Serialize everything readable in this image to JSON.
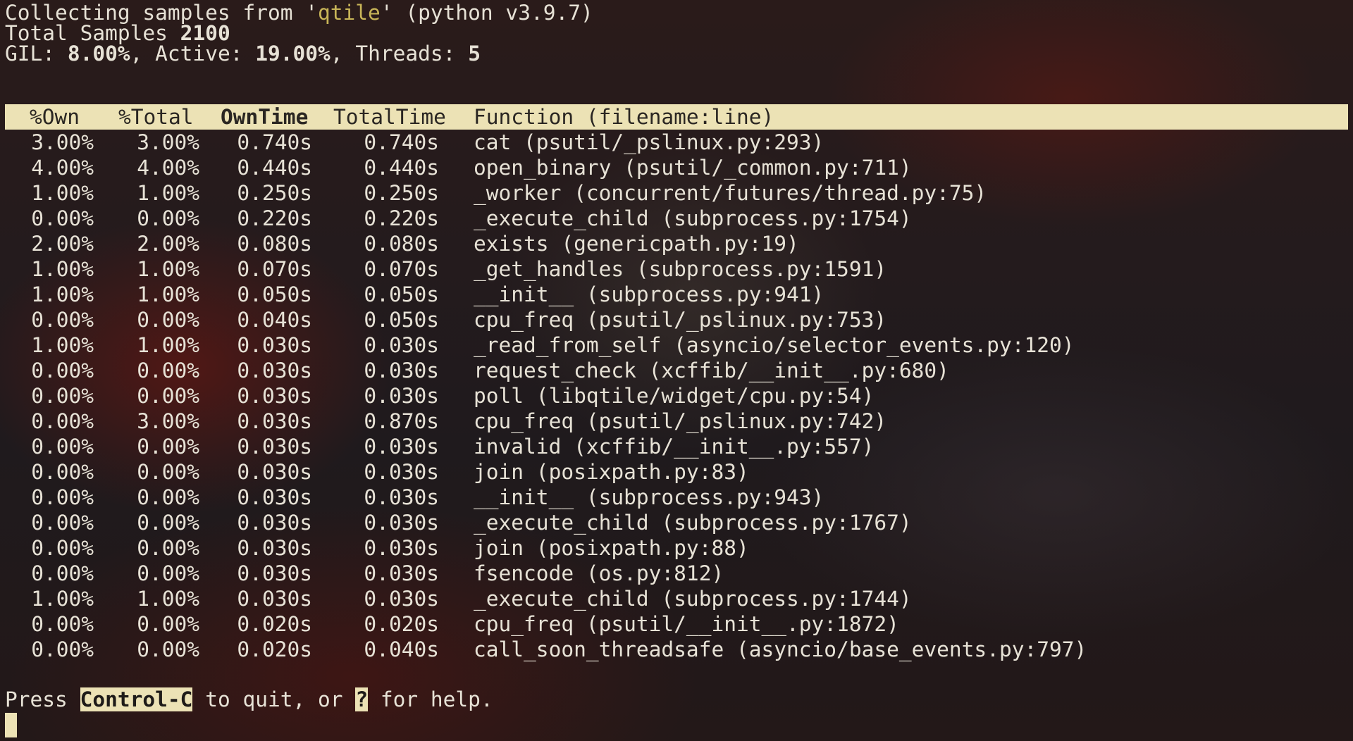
{
  "status": {
    "collecting_prefix": "Collecting samples from '",
    "process_name": "qtile",
    "collecting_suffix": "' (python v3.9.7)",
    "total_samples_label": "Total Samples ",
    "total_samples_value": "2100",
    "gil_label": "GIL: ",
    "gil_value": "8.00%",
    "active_label": ", Active: ",
    "active_value": "19.00%",
    "threads_label": ", Threads: ",
    "threads_value": "5"
  },
  "table": {
    "columns": [
      "%Own",
      "%Total",
      "OwnTime",
      "TotalTime",
      "Function (filename:line)"
    ],
    "sorted_column": "OwnTime",
    "rows": [
      [
        "3.00%",
        "3.00%",
        "0.740s",
        "0.740s",
        "cat (psutil/_pslinux.py:293)"
      ],
      [
        "4.00%",
        "4.00%",
        "0.440s",
        "0.440s",
        "open_binary (psutil/_common.py:711)"
      ],
      [
        "1.00%",
        "1.00%",
        "0.250s",
        "0.250s",
        "_worker (concurrent/futures/thread.py:75)"
      ],
      [
        "0.00%",
        "0.00%",
        "0.220s",
        "0.220s",
        "_execute_child (subprocess.py:1754)"
      ],
      [
        "2.00%",
        "2.00%",
        "0.080s",
        "0.080s",
        "exists (genericpath.py:19)"
      ],
      [
        "1.00%",
        "1.00%",
        "0.070s",
        "0.070s",
        "_get_handles (subprocess.py:1591)"
      ],
      [
        "1.00%",
        "1.00%",
        "0.050s",
        "0.050s",
        "__init__ (subprocess.py:941)"
      ],
      [
        "0.00%",
        "0.00%",
        "0.040s",
        "0.050s",
        "cpu_freq (psutil/_pslinux.py:753)"
      ],
      [
        "1.00%",
        "1.00%",
        "0.030s",
        "0.030s",
        "_read_from_self (asyncio/selector_events.py:120)"
      ],
      [
        "0.00%",
        "0.00%",
        "0.030s",
        "0.030s",
        "request_check (xcffib/__init__.py:680)"
      ],
      [
        "0.00%",
        "0.00%",
        "0.030s",
        "0.030s",
        "poll (libqtile/widget/cpu.py:54)"
      ],
      [
        "0.00%",
        "3.00%",
        "0.030s",
        "0.870s",
        "cpu_freq (psutil/_pslinux.py:742)"
      ],
      [
        "0.00%",
        "0.00%",
        "0.030s",
        "0.030s",
        "invalid (xcffib/__init__.py:557)"
      ],
      [
        "0.00%",
        "0.00%",
        "0.030s",
        "0.030s",
        "join (posixpath.py:83)"
      ],
      [
        "0.00%",
        "0.00%",
        "0.030s",
        "0.030s",
        "__init__ (subprocess.py:943)"
      ],
      [
        "0.00%",
        "0.00%",
        "0.030s",
        "0.030s",
        "_execute_child (subprocess.py:1767)"
      ],
      [
        "0.00%",
        "0.00%",
        "0.030s",
        "0.030s",
        "join (posixpath.py:88)"
      ],
      [
        "0.00%",
        "0.00%",
        "0.030s",
        "0.030s",
        "fsencode (os.py:812)"
      ],
      [
        "1.00%",
        "1.00%",
        "0.030s",
        "0.030s",
        "_execute_child (subprocess.py:1744)"
      ],
      [
        "0.00%",
        "0.00%",
        "0.020s",
        "0.020s",
        "cpu_freq (psutil/__init__.py:1872)"
      ],
      [
        "0.00%",
        "0.00%",
        "0.020s",
        "0.040s",
        "call_soon_threadsafe (asyncio/base_events.py:797)"
      ]
    ]
  },
  "footer": {
    "prefix": "Press ",
    "quit_key": "Control-C",
    "middle": " to quit, or ",
    "help_key": "?",
    "suffix": " for help."
  },
  "colors": {
    "text": "#e7e2d6",
    "process_name": "#c8b558",
    "header_bar": "#ece2b5",
    "header_text": "#2a2622"
  }
}
